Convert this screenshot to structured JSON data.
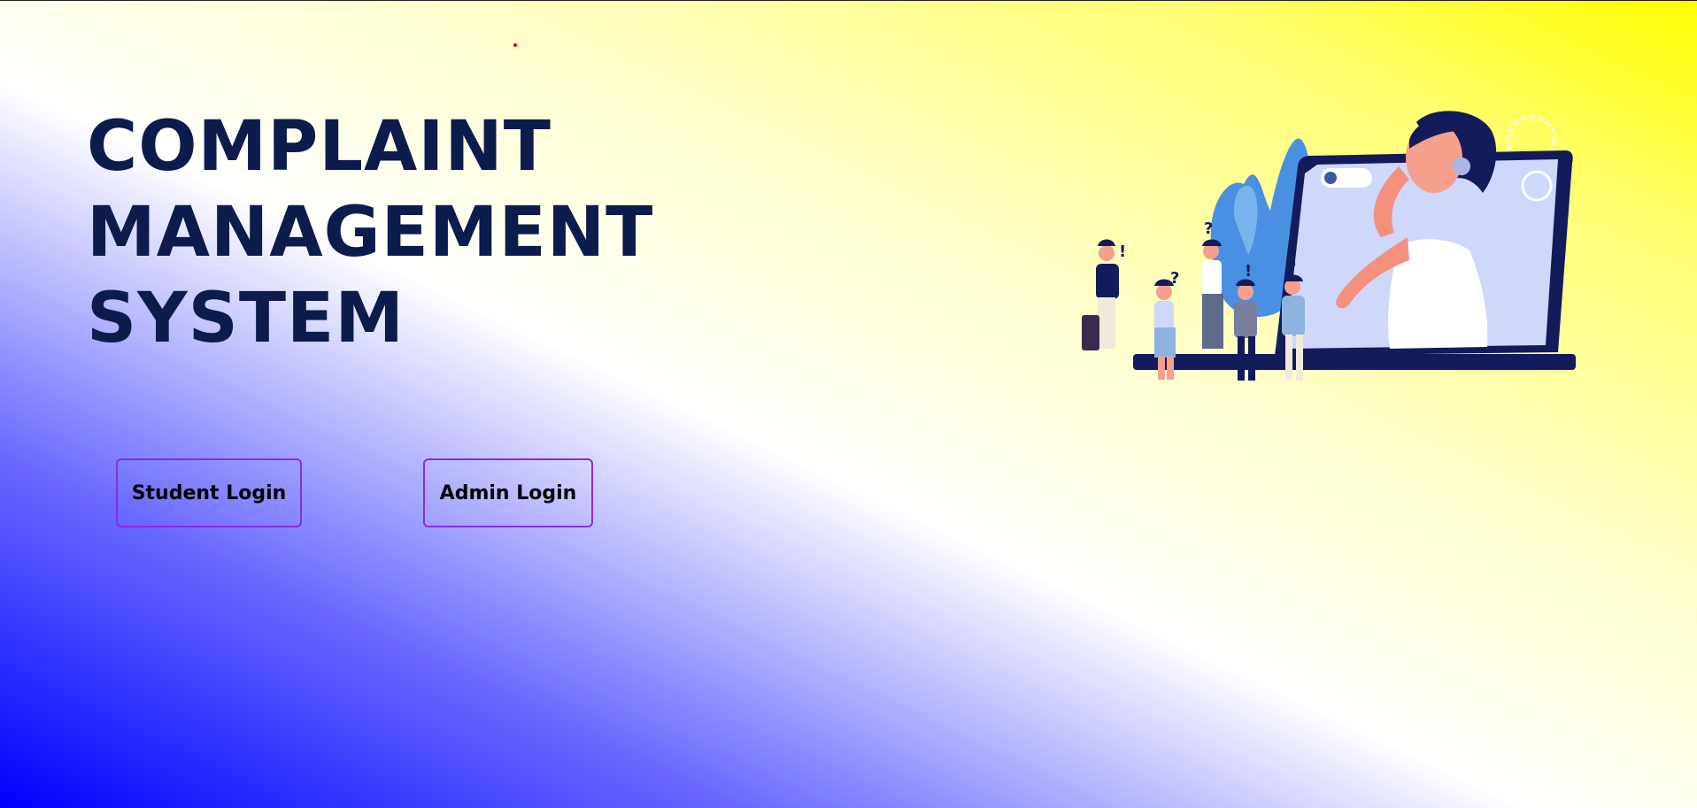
{
  "hero": {
    "title_lines": [
      "COMPLAINT",
      "MANAGEMENT",
      "SYSTEM"
    ]
  },
  "buttons": {
    "student_login": "Student Login",
    "admin_login": "Admin Login"
  },
  "illustration": {
    "icon": "customer-support-illustration",
    "marks": [
      "!",
      "?",
      "?",
      "!",
      "?"
    ]
  },
  "colors": {
    "title": "#0d1b4d",
    "button_border": "#8a2be2",
    "accent_dot": "#e00000",
    "gradient_start": "#0000ff",
    "gradient_end": "#ffff00"
  }
}
